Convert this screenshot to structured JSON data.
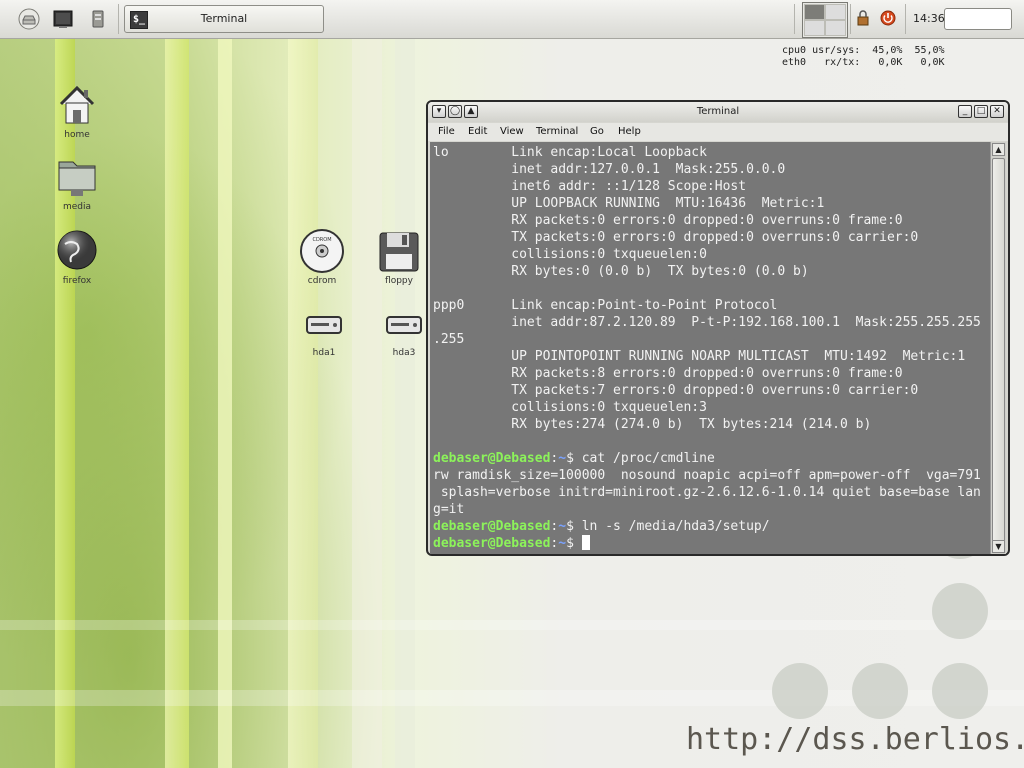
{
  "panel": {
    "task_title": "Terminal",
    "task_icon_glyph": "$_",
    "clock": "14:36",
    "launchers": [
      "home-launcher-icon",
      "terminal-launcher-icon",
      "sysinfo-launcher-icon"
    ],
    "tray_icons": [
      "lock-icon",
      "power-icon"
    ]
  },
  "monitor": {
    "line1": "cpu0 usr/sys:  45,0%  55,0%",
    "line2": "eth0   rx/tx:   0,0K   0,0K"
  },
  "desktop_icons": {
    "home": "home",
    "media": "media",
    "firefox": "firefox",
    "cdrom": "cdrom",
    "floppy": "floppy",
    "hda1": "hda1",
    "hda3": "hda3"
  },
  "window": {
    "title": "Terminal",
    "menu": [
      "File",
      "Edit",
      "View",
      "Terminal",
      "Go",
      "Help"
    ]
  },
  "terminal": {
    "lines": [
      "lo        Link encap:Local Loopback",
      "          inet addr:127.0.0.1  Mask:255.0.0.0",
      "          inet6 addr: ::1/128 Scope:Host",
      "          UP LOOPBACK RUNNING  MTU:16436  Metric:1",
      "          RX packets:0 errors:0 dropped:0 overruns:0 frame:0",
      "          TX packets:0 errors:0 dropped:0 overruns:0 carrier:0",
      "          collisions:0 txqueuelen:0",
      "          RX bytes:0 (0.0 b)  TX bytes:0 (0.0 b)",
      "",
      "ppp0      Link encap:Point-to-Point Protocol",
      "          inet addr:87.2.120.89  P-t-P:192.168.100.1  Mask:255.255.255",
      ".255",
      "          UP POINTOPOINT RUNNING NOARP MULTICAST  MTU:1492  Metric:1",
      "          RX packets:8 errors:0 dropped:0 overruns:0 frame:0",
      "          TX packets:7 errors:0 dropped:0 overruns:0 carrier:0",
      "          collisions:0 txqueuelen:3",
      "          RX bytes:274 (274.0 b)  TX bytes:214 (214.0 b)",
      ""
    ],
    "prompt_user": "debaser@Debased",
    "prompt_sep": ":",
    "prompt_path": "~",
    "prompt_sign": "$",
    "cmd1": " cat /proc/cmdline",
    "output1": "rw ramdisk_size=100000  nosound noapic acpi=off apm=power-off  vga=791",
    "output2": " splash=verbose initrd=miniroot.gz-2.6.12.6-1.0.14 quiet base=base lan",
    "output3": "g=it",
    "cmd2": " ln -s /media/hda3/setup/",
    "cmd3": " "
  },
  "watermark": "http://dss.berlios.de"
}
